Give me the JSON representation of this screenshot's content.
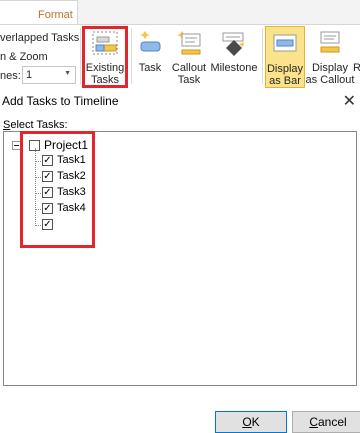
{
  "ribbon": {
    "active_tab": "Format",
    "options": {
      "overlapped": "verlapped Tasks",
      "pan_zoom": "n & Zoom",
      "lines_label": "nes:",
      "lines_value": "1"
    },
    "buttons": {
      "existing_tasks": [
        "Existing",
        "Tasks"
      ],
      "task": [
        "Task",
        ""
      ],
      "callout_task": [
        "Callout",
        "Task"
      ],
      "milestone": [
        "Milestone",
        ""
      ],
      "display_as_bar": [
        "Display",
        "as Bar"
      ],
      "display_as_callout": [
        "Display",
        "as Callout"
      ],
      "extra": "R"
    }
  },
  "dialog": {
    "title": "Add Tasks to Timeline",
    "close_glyph": "✕",
    "select_label": "Select Tasks:",
    "select_label_mnemonic": "S",
    "select_label_rest": "elect Tasks:",
    "tree": {
      "root": {
        "label": "Project1",
        "checked": false,
        "expander": "−"
      },
      "children": [
        {
          "label": "Task1",
          "checked": true
        },
        {
          "label": "Task2",
          "checked": true
        },
        {
          "label": "Task3",
          "checked": true
        },
        {
          "label": "Task4",
          "checked": true
        },
        {
          "label": "",
          "checked": true
        }
      ]
    },
    "ok": {
      "mnemonic": "O",
      "rest": "K"
    },
    "cancel": {
      "mnemonic": "C",
      "rest": "ancel"
    }
  },
  "colors": {
    "highlight_red": "#e3262c",
    "selected_button": "#fbe38b",
    "tab_text": "#b8742a"
  },
  "icons": {
    "existing_tasks": "existing-tasks-icon",
    "task": "task-bar-icon",
    "callout_task": "callout-task-icon",
    "milestone": "milestone-icon",
    "display_as_bar": "display-bar-icon",
    "display_as_callout": "display-callout-icon",
    "check": "✓"
  }
}
